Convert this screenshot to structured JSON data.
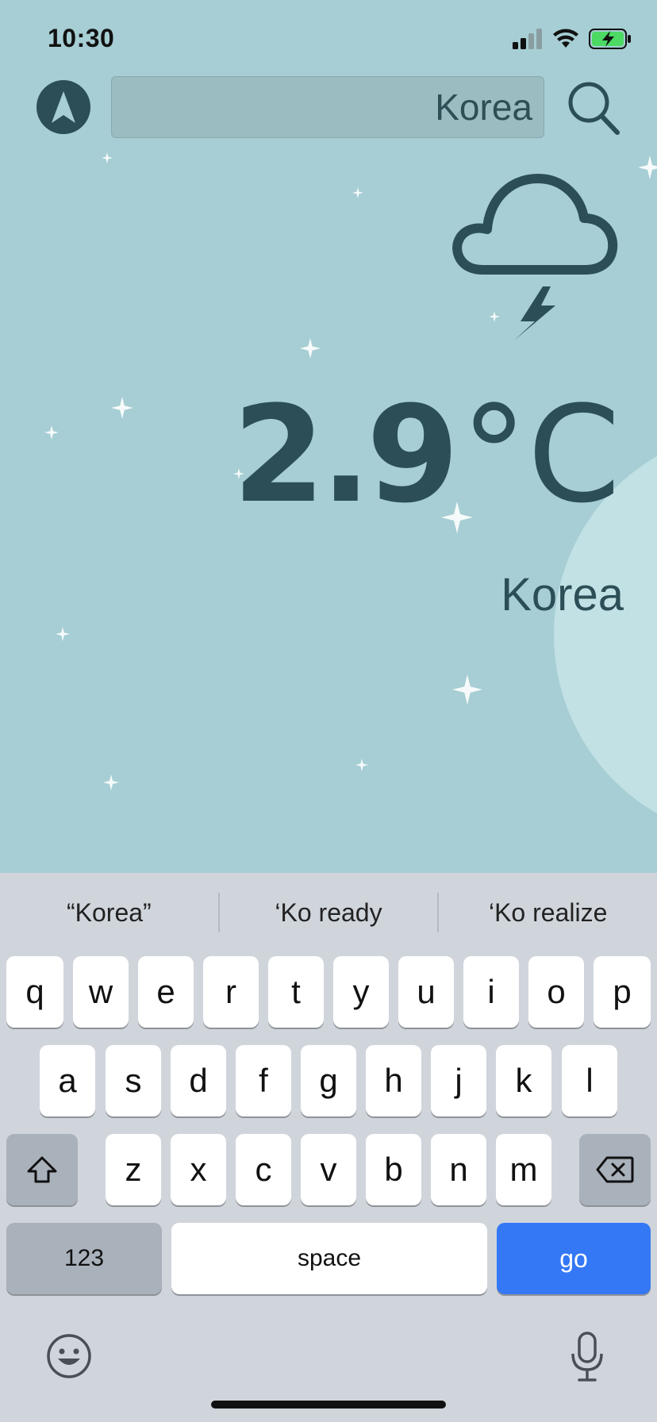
{
  "status_bar": {
    "time": "10:30"
  },
  "search": {
    "value": "Korea"
  },
  "weather": {
    "condition_icon": "cloud-lightning-icon",
    "temperature": "2.9",
    "unit": "°C",
    "city": "Korea"
  },
  "colors": {
    "background": "#a6ced4",
    "primary": "#2c4e56",
    "keyboard_bg": "#d0d5dc",
    "go_key": "#3478f6"
  },
  "keyboard": {
    "suggestions": [
      "“Korea”",
      "‘Ko ready",
      "‘Ko realize"
    ],
    "row1": [
      "q",
      "w",
      "e",
      "r",
      "t",
      "y",
      "u",
      "i",
      "o",
      "p"
    ],
    "row2": [
      "a",
      "s",
      "d",
      "f",
      "g",
      "h",
      "j",
      "k",
      "l"
    ],
    "row3": [
      "z",
      "x",
      "c",
      "v",
      "b",
      "n",
      "m"
    ],
    "numbers_label": "123",
    "space_label": "space",
    "go_label": "go"
  }
}
